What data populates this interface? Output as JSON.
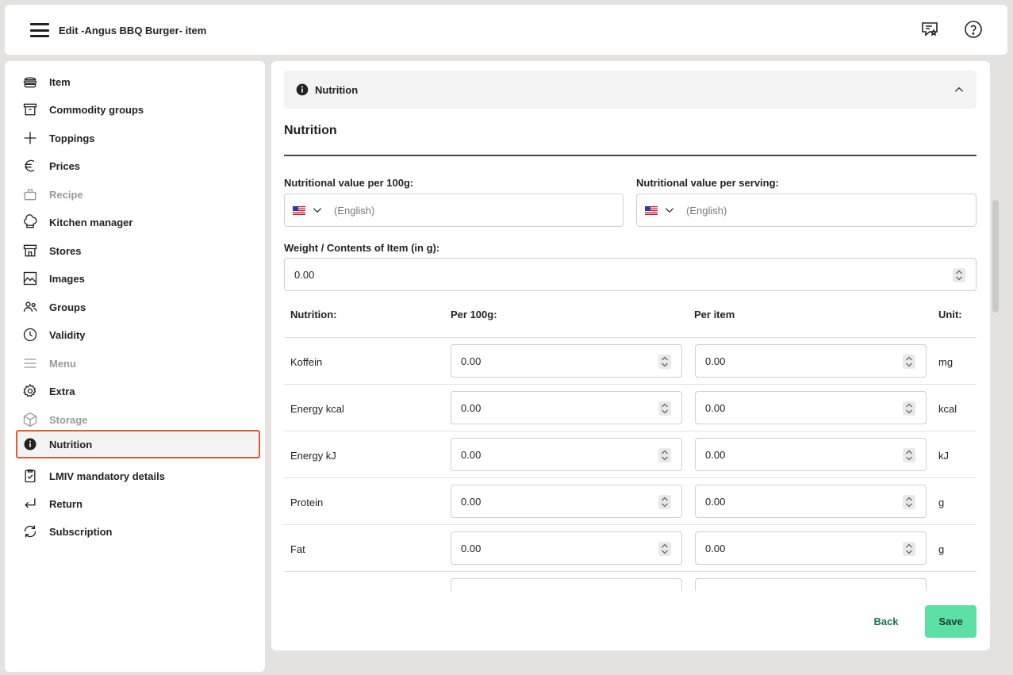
{
  "header": {
    "title": "Edit -Angus BBQ Burger- item",
    "icons": [
      "menu-icon",
      "feedback-icon",
      "help-icon"
    ]
  },
  "sidebar": {
    "items": [
      {
        "label": "Item",
        "icon": "burger-icon",
        "disabled": false
      },
      {
        "label": "Commodity groups",
        "icon": "box-icon",
        "disabled": false
      },
      {
        "label": "Toppings",
        "icon": "plus-icon",
        "disabled": false
      },
      {
        "label": "Prices",
        "icon": "euro-icon",
        "disabled": false
      },
      {
        "label": "Recipe",
        "icon": "pot-icon",
        "disabled": true
      },
      {
        "label": "Kitchen manager",
        "icon": "chef-hat-icon",
        "disabled": false
      },
      {
        "label": "Stores",
        "icon": "store-icon",
        "disabled": false
      },
      {
        "label": "Images",
        "icon": "image-icon",
        "disabled": false
      },
      {
        "label": "Groups",
        "icon": "users-icon",
        "disabled": false
      },
      {
        "label": "Validity",
        "icon": "clock-icon",
        "disabled": false
      },
      {
        "label": "Menu",
        "icon": "list-icon",
        "disabled": true
      },
      {
        "label": "Extra",
        "icon": "gear-icon",
        "disabled": false
      },
      {
        "label": "Storage",
        "icon": "cube-icon",
        "disabled": true
      },
      {
        "label": "Nutrition",
        "icon": "info-icon",
        "disabled": false,
        "active": true
      },
      {
        "label": "LMIV mandatory details",
        "icon": "clipboard-check-icon",
        "disabled": false
      },
      {
        "label": "Return",
        "icon": "return-arrow-icon",
        "disabled": false
      },
      {
        "label": "Subscription",
        "icon": "refresh-icon",
        "disabled": false
      }
    ],
    "active_color": "#e05a3d"
  },
  "main": {
    "accordion_title": "Nutrition",
    "section_title": "Nutrition",
    "per100g_label": "Nutritional value per 100g:",
    "per100g_placeholder": "(English)",
    "perserving_label": "Nutritional value per serving:",
    "perserving_placeholder": "(English)",
    "weight_label": "Weight / Contents of Item (in g):",
    "weight_value": "0.00",
    "table": {
      "headers": [
        "Nutrition:",
        "Per 100g:",
        "Per item",
        "Unit:"
      ],
      "rows": [
        {
          "name": "Koffein",
          "per100g": "0.00",
          "peritem": "0.00",
          "unit": "mg"
        },
        {
          "name": "Energy kcal",
          "per100g": "0.00",
          "peritem": "0.00",
          "unit": "kcal"
        },
        {
          "name": "Energy kJ",
          "per100g": "0.00",
          "peritem": "0.00",
          "unit": "kJ"
        },
        {
          "name": "Protein",
          "per100g": "0.00",
          "peritem": "0.00",
          "unit": "g"
        },
        {
          "name": "Fat",
          "per100g": "0.00",
          "peritem": "0.00",
          "unit": "g"
        }
      ]
    },
    "back_label": "Back",
    "save_label": "Save",
    "save_color": "#5de0a3"
  }
}
